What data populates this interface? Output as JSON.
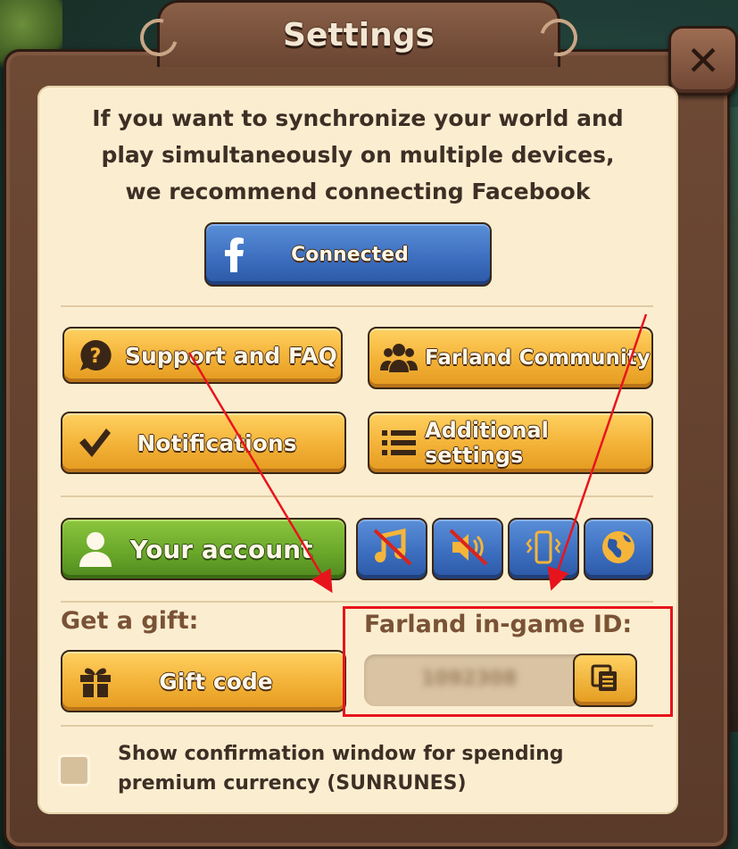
{
  "window": {
    "title": "Settings",
    "close_glyph": "✕"
  },
  "facebook": {
    "message": "If you want to synchronize your world and play simultaneously on multiple devices, we recommend connecting Facebook",
    "button_label": "Connected",
    "icon": "facebook-icon"
  },
  "buttons": {
    "support": {
      "label": "Support and FAQ",
      "icon": "question-icon"
    },
    "community": {
      "label": "Farland Community",
      "icon": "people-icon"
    },
    "notifications": {
      "label": "Notifications",
      "icon": "checkmark-icon"
    },
    "additional": {
      "label": "Additional settings",
      "icon": "list-icon"
    },
    "account": {
      "label": "Your account",
      "icon": "person-icon"
    }
  },
  "toggles": [
    {
      "name": "music-toggle",
      "icon": "music-muted-icon",
      "state": "off"
    },
    {
      "name": "sound-toggle",
      "icon": "speaker-muted-icon",
      "state": "off"
    },
    {
      "name": "vibration-toggle",
      "icon": "vibration-icon",
      "state": "on"
    },
    {
      "name": "language-toggle",
      "icon": "globe-icon",
      "state": "on"
    }
  ],
  "gift": {
    "heading": "Get a gift:",
    "button_label": "Gift code",
    "icon": "gift-icon"
  },
  "game_id": {
    "heading": "Farland in-game ID:",
    "value": "1092308",
    "copy_icon": "copy-icon"
  },
  "confirmation": {
    "label": "Show confirmation window for spending premium currency (SUNRUNES)",
    "checked": false
  },
  "annotation": {
    "highlight_color": "#e8141c"
  },
  "colors": {
    "button_orange": "#f4b43a",
    "button_blue": "#3d6fc0",
    "button_green": "#6aa82a",
    "panel": "#fbeed0",
    "frame": "#6e4a35"
  }
}
